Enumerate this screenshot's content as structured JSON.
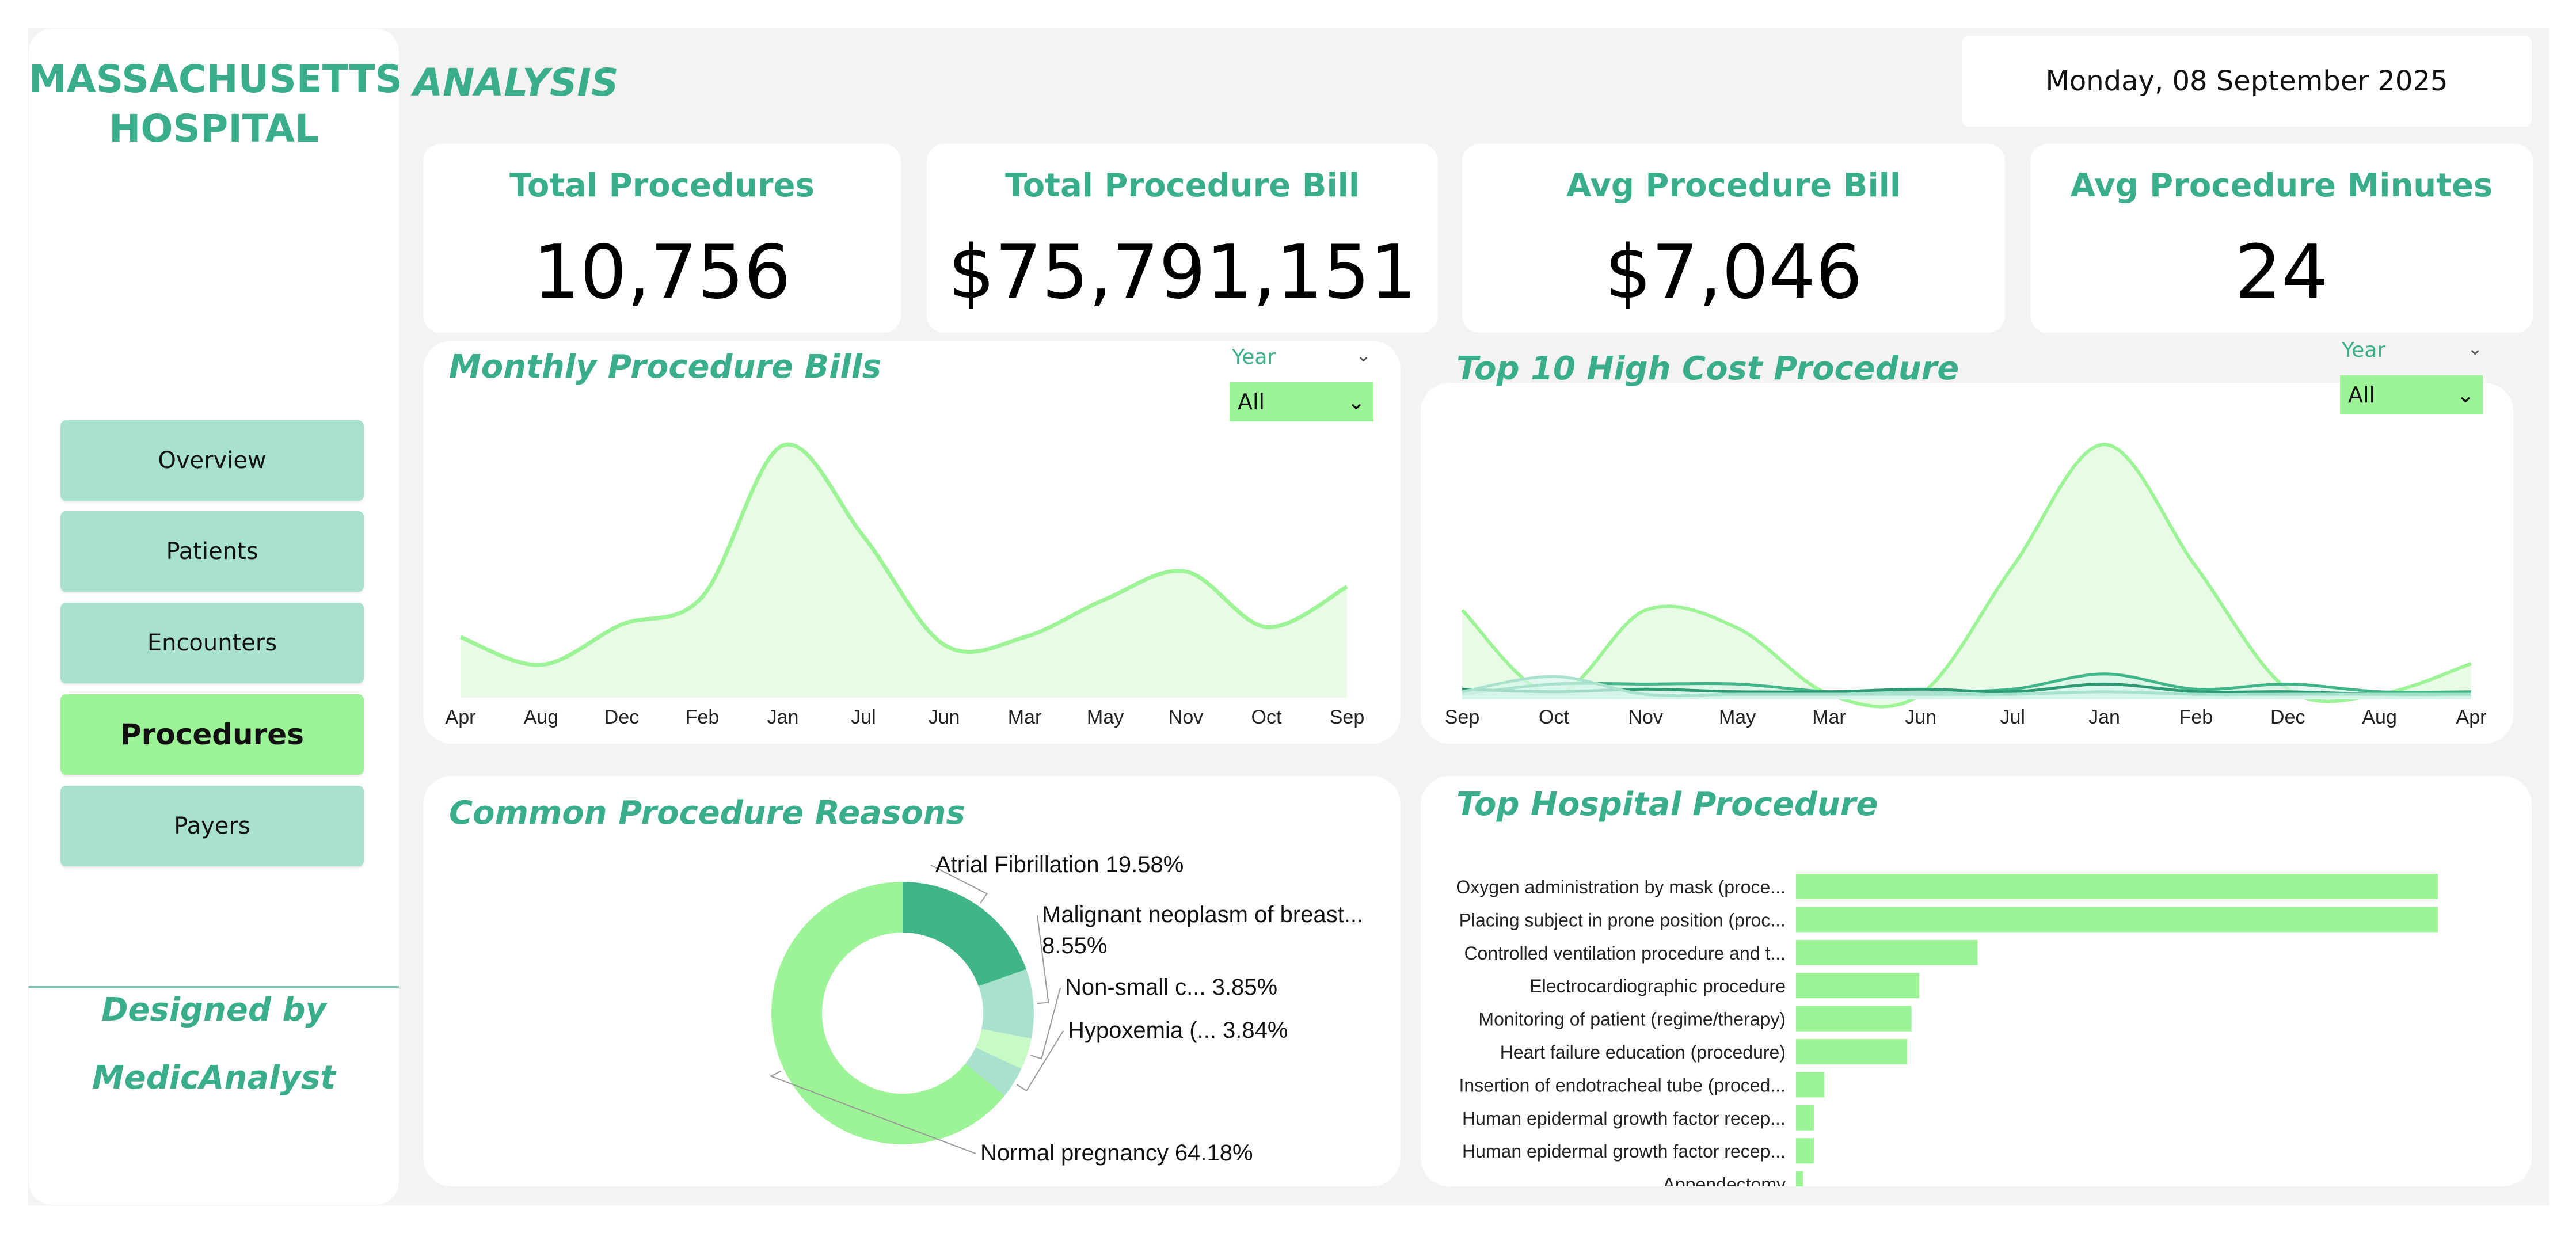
{
  "sidebar": {
    "brand_line1": "MASSACHUSETTS",
    "brand_line2": "HOSPITAL",
    "nav": [
      {
        "label": "Overview"
      },
      {
        "label": "Patients"
      },
      {
        "label": "Encounters"
      },
      {
        "label": "Procedures",
        "active": true
      },
      {
        "label": "Payers"
      }
    ],
    "designed_by": "Designed by",
    "designer": "MedicAnalyst"
  },
  "header": {
    "title": "ANALYSIS",
    "date": "Monday, 08 September 2025"
  },
  "kpis": [
    {
      "label": "Total Procedures",
      "value": "10,756"
    },
    {
      "label": "Total Procedure Bill",
      "value": "$75,791,151"
    },
    {
      "label": "Avg Procedure Bill",
      "value": "$7,046"
    },
    {
      "label": "Avg Procedure Minutes",
      "value": "24"
    }
  ],
  "slicers": {
    "monthly": {
      "label": "Year",
      "value": "All"
    },
    "top10": {
      "label": "Year",
      "value": "All"
    }
  },
  "colors": {
    "accent": "#3aae8a",
    "light_green": "#9df497",
    "nav_bg": "#a8e2cc",
    "donut_dark": "#3fb588"
  },
  "chart_data": [
    {
      "id": "monthly",
      "type": "area",
      "title": "Monthly Procedure Bills",
      "categories": [
        "Apr",
        "Aug",
        "Dec",
        "Feb",
        "Jan",
        "Jul",
        "Jun",
        "Mar",
        "May",
        "Nov",
        "Oct",
        "Sep"
      ],
      "values": [
        0.24,
        0.13,
        0.29,
        0.4,
        1.0,
        0.64,
        0.21,
        0.24,
        0.39,
        0.5,
        0.28,
        0.44
      ],
      "ylim": [
        0,
        1.05
      ],
      "grid": false
    },
    {
      "id": "top10",
      "type": "area",
      "title": "Top 10 High Cost Procedure",
      "categories": [
        "Sep",
        "Oct",
        "Nov",
        "May",
        "Mar",
        "Jun",
        "Jul",
        "Jan",
        "Feb",
        "Dec",
        "Aug",
        "Apr"
      ],
      "series": [
        {
          "values": [
            0.35,
            0.02,
            0.35,
            0.28,
            0.02,
            0.02,
            0.52,
            1.0,
            0.52,
            0.04,
            0.02,
            0.14
          ]
        },
        {
          "values": [
            0.02,
            0.06,
            0.06,
            0.06,
            0.03,
            0.03,
            0.04,
            0.1,
            0.04,
            0.06,
            0.03,
            0.03
          ]
        },
        {
          "values": [
            0.04,
            0.03,
            0.04,
            0.03,
            0.03,
            0.04,
            0.03,
            0.06,
            0.03,
            0.03,
            0.02,
            0.02
          ]
        },
        {
          "values": [
            0.03,
            0.09,
            0.02,
            0.02,
            0.02,
            0.02,
            0.02,
            0.03,
            0.02,
            0.02,
            0.02,
            0.02
          ]
        }
      ],
      "ylim": [
        0,
        1.05
      ],
      "grid": false
    },
    {
      "id": "reasons",
      "type": "pie",
      "title": "Common Procedure Reasons",
      "slices": [
        {
          "label": "Atrial Fibrillation",
          "short_label": "Atrial Fibrillation 19.58%",
          "value": 19.58,
          "color": "#3fb588"
        },
        {
          "label": "Malignant neoplasm of breast...",
          "short_label": "Malignant neoplasm of breast...",
          "pct_label": "8.55%",
          "value": 8.55,
          "color": "#a8e2cc"
        },
        {
          "label": "Non-small c...",
          "short_label": "Non-small c... 3.85%",
          "value": 3.85,
          "color": "#c9f9c5"
        },
        {
          "label": "Hypoxemia (...",
          "short_label": "Hypoxemia (... 3.84%",
          "value": 3.84,
          "color": "#a8e2cc"
        },
        {
          "label": "Normal pregnancy",
          "short_label": "Normal pregnancy 64.18%",
          "value": 64.18,
          "color": "#9df497"
        }
      ]
    },
    {
      "id": "top_hospital",
      "type": "bar",
      "title": "Top Hospital Procedure",
      "categories": [
        "Oxygen administration by mask (proce...",
        "Placing subject in prone position (proc...",
        "Controlled ventilation procedure and t...",
        "Electrocardiographic procedure",
        "Monitoring of patient (regime/therapy)",
        "Heart failure education (procedure)",
        "Insertion of endotracheal tube (proced...",
        "Human epidermal growth factor recep...",
        "Human epidermal growth factor recep...",
        "Appendectomy"
      ],
      "values": [
        1000,
        1000,
        283,
        192,
        180,
        173,
        44,
        28,
        28,
        11
      ]
    }
  ]
}
